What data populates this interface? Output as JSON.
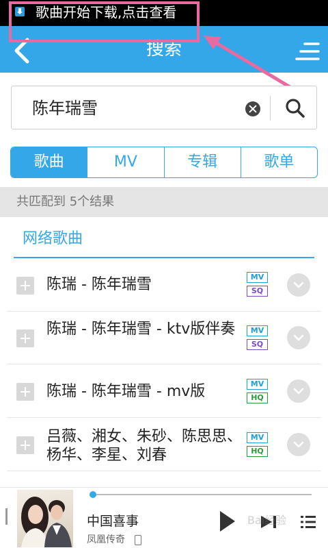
{
  "status_bar": {
    "notification": "歌曲开始下载,点击查看"
  },
  "header": {
    "title": "搜索"
  },
  "search": {
    "value": "陈年瑞雪"
  },
  "tabs": [
    {
      "label": "歌曲",
      "active": true
    },
    {
      "label": "MV",
      "active": false
    },
    {
      "label": "专辑",
      "active": false
    },
    {
      "label": "歌单",
      "active": false
    }
  ],
  "result_summary": "共匹配到 5个结果",
  "section_title": "网络歌曲",
  "songs": [
    {
      "title": "陈瑞 - 陈年瑞雪",
      "badges": [
        "MV",
        "SQ"
      ]
    },
    {
      "title": "陈瑞 - 陈年瑞雪 - ktv版伴奏",
      "badges": [
        "MV",
        "SQ"
      ]
    },
    {
      "title": "陈瑞 - 陈年瑞雪 - mv版",
      "badges": [
        "MV",
        "HQ"
      ]
    },
    {
      "title": "吕薇、湘女、朱砂、陈思思、杨华、李星、刘春",
      "badges": [
        "MV",
        "HQ"
      ]
    }
  ],
  "player": {
    "title": "中国喜事",
    "artist": "凤凰传奇",
    "progress": 0.0
  },
  "watermark": "Bai经验",
  "colors": {
    "accent": "#33a7e8",
    "highlight": "#e86aa0",
    "sq": "#7d4bc4",
    "hq": "#2b9c3a"
  }
}
